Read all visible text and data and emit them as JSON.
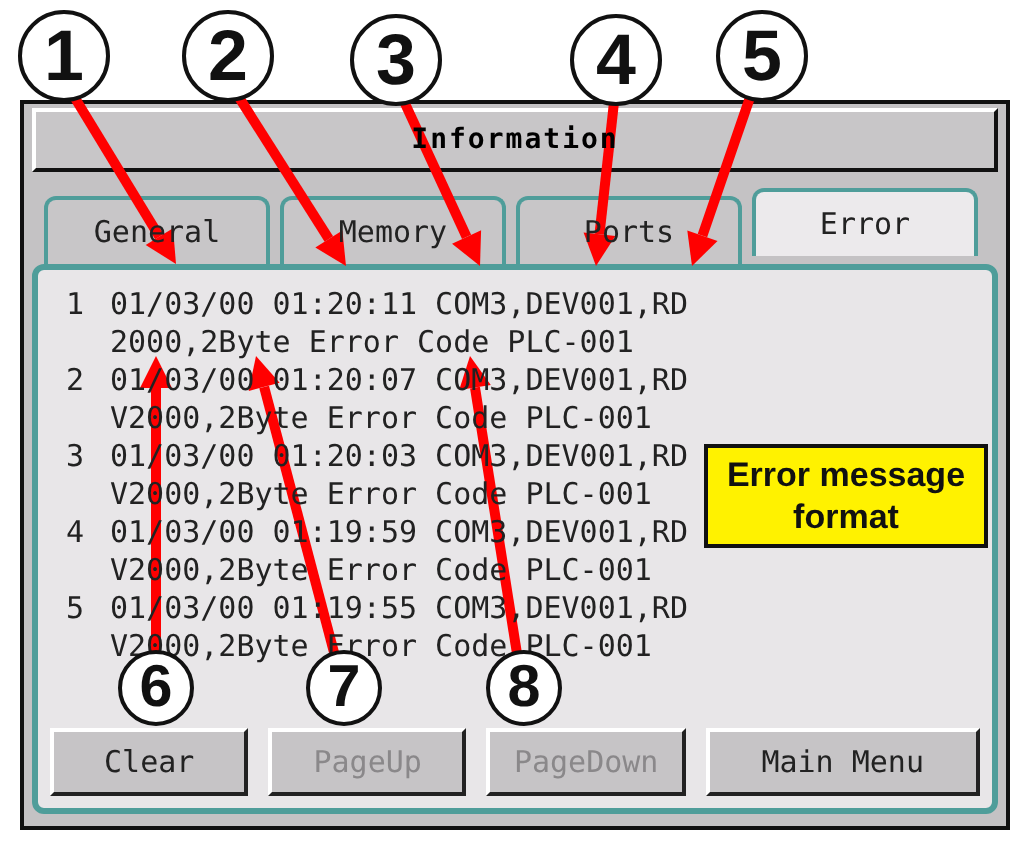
{
  "window": {
    "title": "Information"
  },
  "tabs": [
    {
      "label": "General",
      "selected": false
    },
    {
      "label": "Memory",
      "selected": false
    },
    {
      "label": "Ports",
      "selected": false
    },
    {
      "label": "Error",
      "selected": true
    }
  ],
  "entries": [
    {
      "index": "1",
      "line1": "01/03/00 01:20:11 COM3,DEV001,RD",
      "line2": "2000,2Byte Error Code PLC-001"
    },
    {
      "index": "2",
      "line1": "01/03/00 01:20:07 COM3,DEV001,RD",
      "line2": "V2000,2Byte Error Code PLC-001"
    },
    {
      "index": "3",
      "line1": "01/03/00 01:20:03 COM3,DEV001,RD",
      "line2": "V2000,2Byte Error Code PLC-001"
    },
    {
      "index": "4",
      "line1": "01/03/00 01:19:59 COM3,DEV001,RD",
      "line2": "V2000,2Byte Error Code PLC-001"
    },
    {
      "index": "5",
      "line1": "01/03/00 01:19:55 COM3,DEV001,RD",
      "line2": "V2000,2Byte Error Code PLC-001"
    }
  ],
  "buttons": [
    {
      "label": "Clear",
      "disabled": false
    },
    {
      "label": "PageUp",
      "disabled": true
    },
    {
      "label": "PageDown",
      "disabled": true
    },
    {
      "label": "Main Menu",
      "disabled": false
    }
  ],
  "callouts": [
    {
      "number": "1"
    },
    {
      "number": "2"
    },
    {
      "number": "3"
    },
    {
      "number": "4"
    },
    {
      "number": "5"
    },
    {
      "number": "6"
    },
    {
      "number": "7"
    },
    {
      "number": "8"
    }
  ],
  "note": "Error message format"
}
